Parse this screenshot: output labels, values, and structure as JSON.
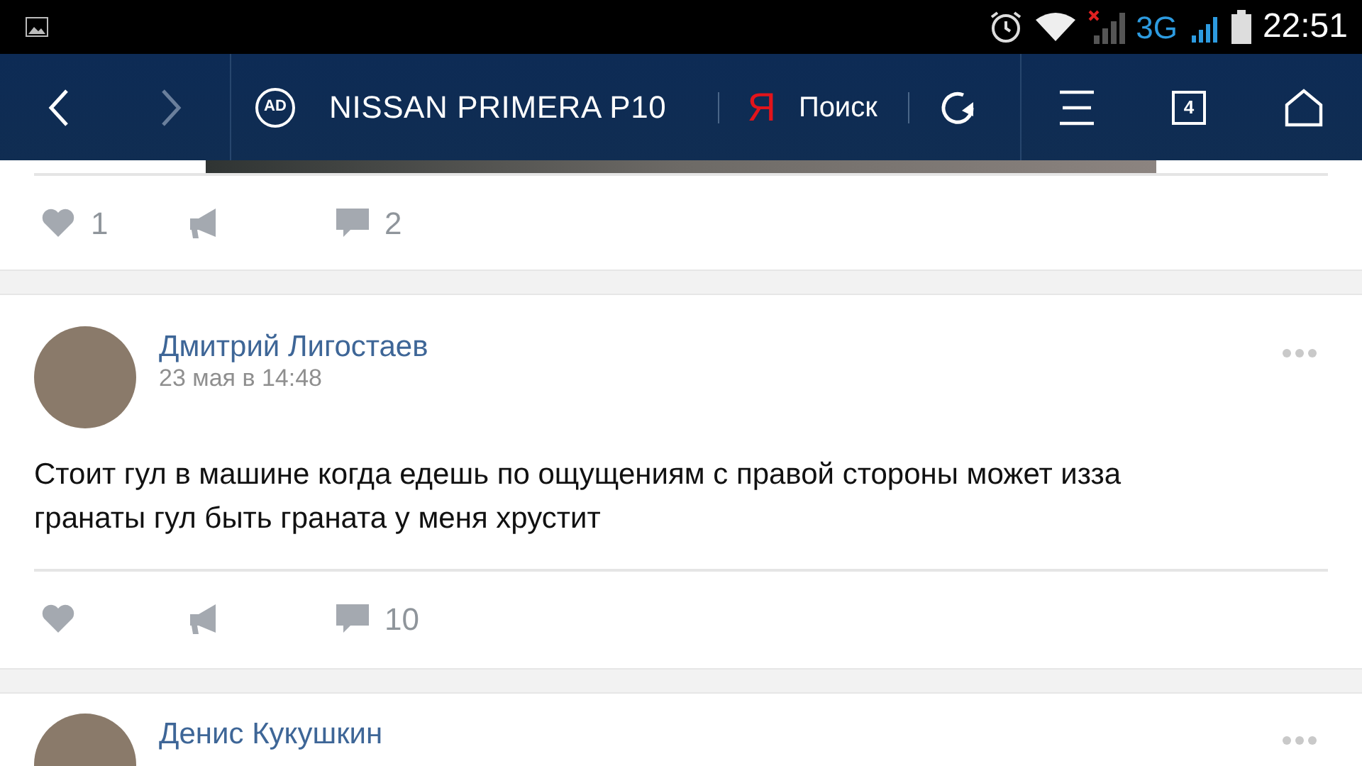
{
  "status_bar": {
    "network": "3G",
    "time": "22:51"
  },
  "toolbar": {
    "adblock_label": "AD",
    "title": "NISSAN PRIMERA P10",
    "search_logo": "Я",
    "search_label": "Поиск",
    "tabs_count": "4"
  },
  "posts": [
    {
      "kind": "tail",
      "likes": "1",
      "comments": "2"
    },
    {
      "kind": "full",
      "author": "Дмитрий Лигостаев",
      "date": "23 мая в 14:48",
      "text": "Стоит гул в машине когда едешь по ощущениям с правой стороны может изза гранаты гул быть граната у меня хрустит",
      "comments": "10"
    },
    {
      "kind": "head",
      "author": "Денис Кукушкин"
    }
  ]
}
